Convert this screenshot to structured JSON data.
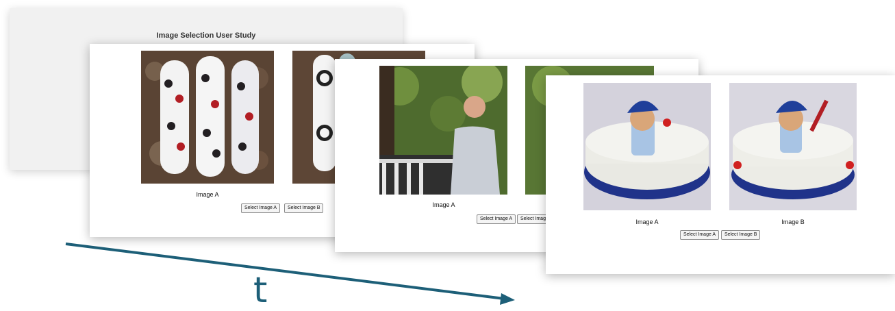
{
  "colors": {
    "accent": "#1d5f78",
    "card_background": "#ffffff",
    "back_card_background": "#f1f1f1",
    "button_background": "#f4f4f4",
    "button_border": "#8c8c8c"
  },
  "screen1": {
    "title": "Image Selection User Study"
  },
  "screen2": {
    "image_a_label": "Image A",
    "image_a_content": "panda-skateboards-photo",
    "image_b_content": "panda-skateboard-photo",
    "select_a_label": "Select Image A",
    "select_b_label": "Select Image B"
  },
  "screen3": {
    "image_a_label": "Image A",
    "image_a_content": "man-on-balcony-photo",
    "image_b_content": "trees-photo",
    "select_a_label": "Select Image A",
    "select_b_label": "Select Image B"
  },
  "screen4": {
    "image_a_label": "Image A",
    "image_b_label": "Image B",
    "image_a_content": "baseball-cake-photo",
    "image_b_content": "baseball-cake-photo",
    "select_a_label": "Select Image A",
    "select_b_label": "Select Image B"
  },
  "time_axis": {
    "label": "t"
  }
}
